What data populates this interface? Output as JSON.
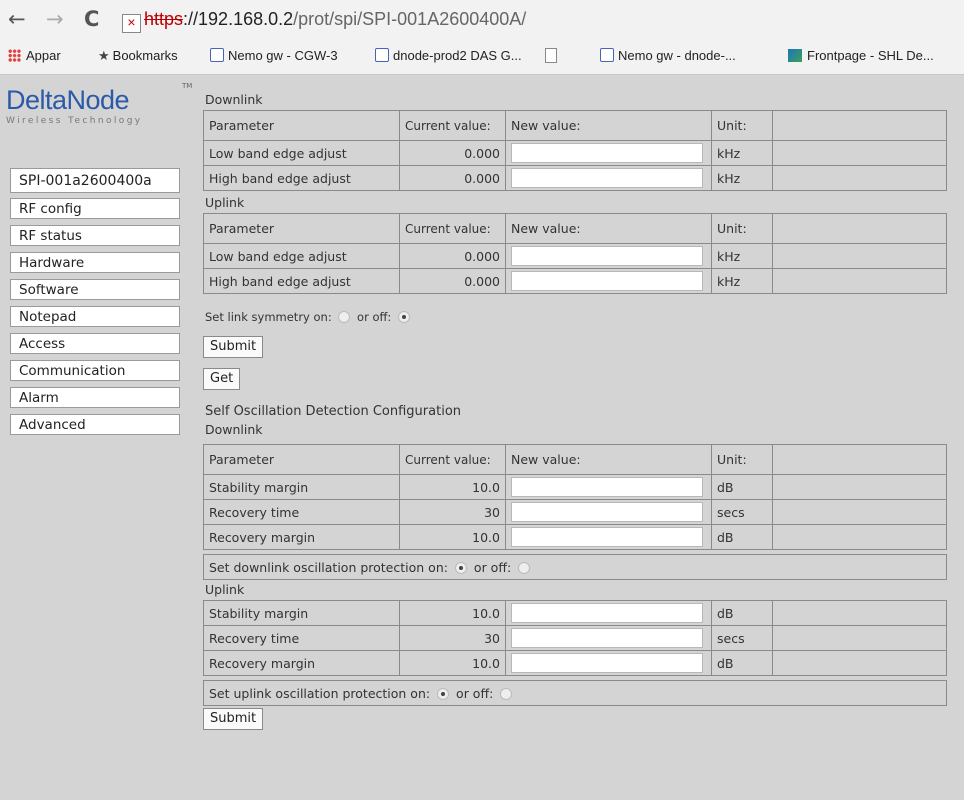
{
  "browser": {
    "url_protocol": "https",
    "url_host": "://192.168.0.2",
    "url_path": "/prot/spi/SPI-001A2600400A/",
    "bookmarks": [
      {
        "label": "Appar",
        "icon": "apps-grid-icon"
      },
      {
        "label": "Bookmarks",
        "icon": "star-icon"
      },
      {
        "label": "Nemo gw - CGW-3",
        "icon": "page-icon"
      },
      {
        "label": "dnode-prod2 DAS G...",
        "icon": "page-icon"
      },
      {
        "label": "",
        "icon": "document-icon"
      },
      {
        "label": "Nemo gw - dnode-...",
        "icon": "page-icon"
      },
      {
        "label": "Frontpage - SHL De...",
        "icon": "site-icon"
      }
    ]
  },
  "logo": {
    "name": "DeltaNode",
    "tagline": "Wireless  Technology",
    "tm": "TM"
  },
  "sidebar": {
    "items": [
      "SPI-001a2600400a",
      "RF config",
      "RF status",
      "Hardware",
      "Software",
      "Notepad",
      "Access",
      "Communication",
      "Alarm",
      "Advanced"
    ]
  },
  "band_edge": {
    "downlink_label": "Downlink",
    "uplink_label": "Uplink",
    "headers": {
      "parameter": "Parameter",
      "current": "Current value:",
      "new": "New value:",
      "unit": "Unit:"
    },
    "downlink_rows": [
      {
        "param": "Low band edge adjust",
        "value": "0.000",
        "unit": "kHz"
      },
      {
        "param": "High band edge adjust",
        "value": "0.000",
        "unit": "kHz"
      }
    ],
    "uplink_rows": [
      {
        "param": "Low band edge adjust",
        "value": "0.000",
        "unit": "kHz"
      },
      {
        "param": "High band edge adjust",
        "value": "0.000",
        "unit": "kHz"
      }
    ],
    "symmetry_label": "Set link symmetry on:",
    "off_label": "or off:",
    "symmetry_on": false,
    "submit_label": "Submit",
    "get_label": "Get"
  },
  "self_osc": {
    "title": "Self Oscillation Detection Configuration",
    "downlink_label": "Downlink",
    "uplink_label": "Uplink",
    "headers": {
      "parameter": "Parameter",
      "current": "Current value:",
      "new": "New value:",
      "unit": "Unit:"
    },
    "downlink_rows": [
      {
        "param": "Stability margin",
        "value": "10.0",
        "unit": "dB"
      },
      {
        "param": "Recovery time",
        "value": "30",
        "unit": "secs"
      },
      {
        "param": "Recovery margin",
        "value": "10.0",
        "unit": "dB"
      }
    ],
    "downlink_protect_label": "Set downlink oscillation protection on:",
    "downlink_protect_on": true,
    "uplink_rows": [
      {
        "param": "Stability margin",
        "value": "10.0",
        "unit": "dB"
      },
      {
        "param": "Recovery time",
        "value": "30",
        "unit": "secs"
      },
      {
        "param": "Recovery margin",
        "value": "10.0",
        "unit": "dB"
      }
    ],
    "uplink_protect_label": "Set uplink oscillation protection on:",
    "uplink_protect_on": true,
    "off_label": "or off:",
    "submit_label": "Submit"
  }
}
